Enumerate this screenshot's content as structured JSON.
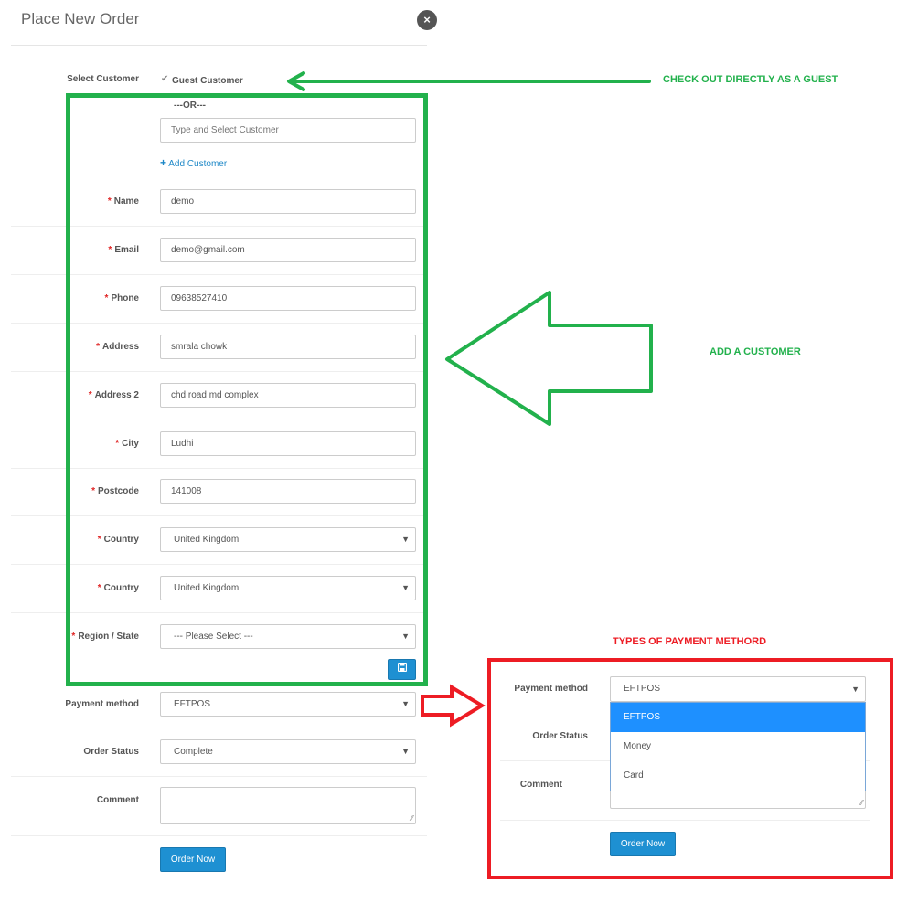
{
  "modal": {
    "title": "Place New Order",
    "close_icon": "×"
  },
  "form": {
    "select_customer_label": "Select Customer",
    "guest_checked_glyph": "✔",
    "guest_label": "Guest Customer",
    "or_text": "---OR---",
    "customer_search_placeholder": "Type and Select Customer",
    "add_customer_plus": "+",
    "add_customer_label": "Add Customer",
    "required_mark": "*",
    "fields": [
      {
        "label": "Name",
        "value": "demo",
        "required": true
      },
      {
        "label": "Email",
        "value": "demo@gmail.com",
        "required": true
      },
      {
        "label": "Phone",
        "value": "09638527410",
        "required": true
      },
      {
        "label": "Address",
        "value": "smrala chowk",
        "required": true
      },
      {
        "label": "Address 2",
        "value": "chd road md complex",
        "required": true
      },
      {
        "label": "City",
        "value": "Ludhi",
        "required": true
      },
      {
        "label": "Postcode",
        "value": "141008",
        "required": true
      }
    ],
    "selects": [
      {
        "label": "Country",
        "value": "United Kingdom",
        "required": true
      },
      {
        "label": "Country",
        "value": "United Kingdom",
        "required": true
      },
      {
        "label": "Region / State",
        "value": "--- Please Select ---",
        "required": true
      }
    ],
    "save_icon": "💾",
    "payment_label": "Payment method",
    "payment_value": "EFTPOS",
    "status_label": "Order Status",
    "status_value": "Complete",
    "comment_label": "Comment",
    "comment_value": "",
    "order_button": "Order Now",
    "caret": "▼"
  },
  "annotations": {
    "guest": "CHECK OUT DIRECTLY AS A GUEST",
    "add_customer": "ADD A CUSTOMER",
    "payment_types": "TYPES OF PAYMENT METHORD",
    "green": "#22b14c",
    "red": "#ed1c24"
  },
  "inset": {
    "payment_label": "Payment method",
    "payment_value": "EFTPOS",
    "status_label": "Order Status",
    "comment_label": "Comment",
    "options": [
      "EFTPOS",
      "Money",
      "Card"
    ],
    "selected_index": 0,
    "order_button": "Order Now"
  }
}
